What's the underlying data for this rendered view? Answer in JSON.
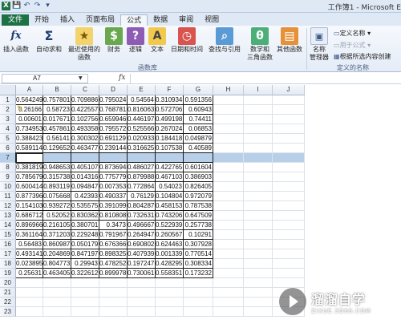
{
  "window": {
    "title": "工作簿1 - Microsoft E"
  },
  "quick_access": {
    "save": "💾",
    "undo": "↶",
    "redo": "↷",
    "more": "▾"
  },
  "tabs": [
    {
      "label": "文件"
    },
    {
      "label": "开始"
    },
    {
      "label": "插入"
    },
    {
      "label": "页面布局"
    },
    {
      "label": "公式"
    },
    {
      "label": "数据"
    },
    {
      "label": "审阅"
    },
    {
      "label": "视图"
    }
  ],
  "active_tab": "公式",
  "ribbon": {
    "insert_function": {
      "icon": "fx",
      "label": "插入函数"
    },
    "autosum": {
      "icon": "Σ",
      "label": "自动求和"
    },
    "recent": {
      "icon": "★",
      "label1": "最近使用的",
      "label2": "函数"
    },
    "financial": {
      "icon": "$",
      "label": "财务"
    },
    "logical": {
      "icon": "?",
      "label": "逻辑"
    },
    "text": {
      "icon": "A",
      "label": "文本"
    },
    "datetime": {
      "icon": "◷",
      "label": "日期和时间"
    },
    "lookup": {
      "icon": "⌕",
      "label": "查找与引用"
    },
    "math": {
      "icon": "θ",
      "label1": "数学和",
      "label2": "三角函数"
    },
    "more": {
      "icon": "▤",
      "label": "其他函数"
    },
    "library_group": "函数库",
    "name_manager": {
      "label1": "名称",
      "label2": "管理器"
    },
    "define_name": "定义名称 ▾",
    "use_in_formula": "用于公式 ▾",
    "create_from_selection": "根据所选内容创建",
    "names_group": "定义的名称"
  },
  "formula_bar": {
    "cell_ref": "A7",
    "fx": "fx",
    "value": ""
  },
  "columns": [
    "A",
    "B",
    "C",
    "D",
    "E",
    "F",
    "G",
    "H",
    "I",
    "J"
  ],
  "rows": [
    {
      "n": "1",
      "v": [
        "0.564249",
        "0.757801",
        "0.709886",
        "0.795024",
        "0.54564",
        "0.310934",
        "0.591356"
      ]
    },
    {
      "n": "2",
      "v": [
        "0.26166",
        "0.58723",
        "0.422557",
        "0.768781",
        "0.816063",
        "0.572706",
        "0.60943"
      ]
    },
    {
      "n": "3",
      "v": [
        "0.00601",
        "0.017671",
        "0.102756",
        "0.659946",
        "0.446197",
        "0.499198",
        "0.74411"
      ]
    },
    {
      "n": "4",
      "v": [
        "0.734953",
        "0.457861",
        "0.493358",
        "0.795572",
        "0.525566",
        "0.267024",
        "0.06853"
      ]
    },
    {
      "n": "5",
      "v": [
        "0.388423",
        "0.56141",
        "0.300302",
        "0.691129",
        "0.020933",
        "0.184418",
        "0.049879"
      ]
    },
    {
      "n": "6",
      "v": [
        "0.589114",
        "0.129652",
        "0.463477",
        "0.239144",
        "0.316625",
        "0.107538",
        "0.40589"
      ]
    },
    {
      "n": "7",
      "v": [
        "",
        "",
        "",
        "",
        "",
        "",
        ""
      ]
    },
    {
      "n": "8",
      "v": [
        "0.381819",
        "0.948653",
        "0.405107",
        "0.873694",
        "0.486027",
        "0.422765",
        "0.601604"
      ]
    },
    {
      "n": "9",
      "v": [
        "0.785679",
        "0.315738",
        "0.014316",
        "0.775779",
        "0.879988",
        "0.467103",
        "0.386903"
      ]
    },
    {
      "n": "10",
      "v": [
        "0.600414",
        "0.893119",
        "0.094847",
        "0.007353",
        "0.772864",
        "0.54023",
        "0.826405"
      ]
    },
    {
      "n": "11",
      "v": [
        "0.877396",
        "0.075668",
        "0.42393",
        "0.490337",
        "0.76129",
        "0.104804",
        "0.972079"
      ]
    },
    {
      "n": "12",
      "v": [
        "0.154103",
        "0.939272",
        "0.535575",
        "0.391099",
        "0.804287",
        "0.458153",
        "0.787538"
      ]
    },
    {
      "n": "13",
      "v": [
        "0.686712",
        "0.52052",
        "0.830362",
        "0.810808",
        "0.732631",
        "0.743206",
        "0.647509"
      ]
    },
    {
      "n": "14",
      "v": [
        "0.896966",
        "0.216105",
        "0.380701",
        "0.3473",
        "0.496667",
        "0.522939",
        "0.257738"
      ]
    },
    {
      "n": "15",
      "v": [
        "0.361164",
        "0.371203",
        "0.229248",
        "0.791967",
        "0.264947",
        "0.260567",
        "0.10291"
      ]
    },
    {
      "n": "16",
      "v": [
        "0.56483",
        "0.860987",
        "0.050179",
        "0.676366",
        "0.690802",
        "0.624463",
        "0.307928"
      ]
    },
    {
      "n": "17",
      "v": [
        "0.493141",
        "0.204869",
        "0.847197",
        "0.898325",
        "0.407939",
        "0.001339",
        "0.770514"
      ]
    },
    {
      "n": "18",
      "v": [
        "0.023895",
        "0.804773",
        "0.29943",
        "0.478252",
        "0.197247",
        "0.428295",
        "0.308334"
      ]
    },
    {
      "n": "19",
      "v": [
        "0.25631",
        "0.463405",
        "0.322612",
        "0.899978",
        "0.730061",
        "0.558351",
        "0.173232"
      ]
    },
    {
      "n": "20",
      "v": [
        "",
        "",
        "",
        "",
        "",
        "",
        ""
      ]
    },
    {
      "n": "21",
      "v": [
        "",
        "",
        "",
        "",
        "",
        "",
        ""
      ]
    },
    {
      "n": "22",
      "v": [
        "",
        "",
        "",
        "",
        "",
        "",
        ""
      ]
    },
    {
      "n": "23",
      "v": [
        "",
        "",
        "",
        "",
        "",
        "",
        ""
      ]
    }
  ],
  "watermark": {
    "main": "溜溜自学",
    "sub": "ZIXUE.3D66.COM"
  }
}
